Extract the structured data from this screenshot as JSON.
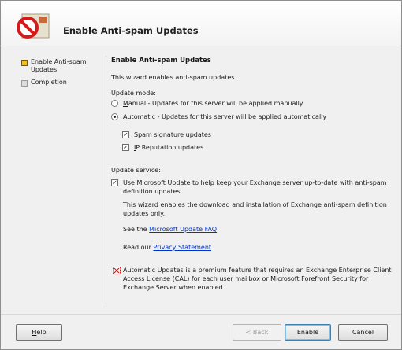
{
  "wizard": {
    "title": "Enable Anti-spam Updates"
  },
  "nav": {
    "items": [
      {
        "label": "Enable Anti-spam Updates",
        "active": true
      },
      {
        "label": "Completion",
        "active": false
      }
    ]
  },
  "page": {
    "heading": "Enable Anti-spam Updates",
    "intro": "This wizard enables anti-spam updates.",
    "update_mode_label": "Update mode:",
    "manual_prefix": "M",
    "manual_label": "anual - Updates for this server will be applied manually",
    "automatic_prefix": "A",
    "automatic_label": "utomatic - Updates for this server will be applied automatically",
    "manual_selected": false,
    "automatic_selected": true,
    "spam_sig_prefix": "S",
    "spam_sig_label": "pam signature updates",
    "spam_sig_checked": true,
    "ip_rep_prefix": "I",
    "ip_rep_label": "P Reputation updates",
    "ip_rep_checked": true,
    "update_service_label": "Update service:",
    "microsoft_update_line1_a": "Use Micr",
    "microsoft_update_line1_u": "o",
    "microsoft_update_line1_b": "soft Update to help keep your Exchange server up-to-date with anti-spam",
    "microsoft_update_line2": "definition updates.",
    "microsoft_update_checked": true,
    "wizard_note_line1": "This wizard enables the download and installation of Exchange anti-spam definition",
    "wizard_note_line2": "updates only.",
    "faq_prefix": "See the ",
    "faq_link": "Microsoft Update FAQ",
    "faq_suffix": ".",
    "privacy_prefix": "Read our ",
    "privacy_link": "Privacy Statement",
    "privacy_suffix": ".",
    "premium_line1": "Automatic Updates is a premium feature that requires an Exchange Enterprise Client",
    "premium_line2": "Access License (CAL) for each user mailbox or Microsoft Forefront Security for",
    "premium_line3": "Exchange Server when enabled."
  },
  "buttons": {
    "help_prefix": "H",
    "help_suffix": "elp",
    "back": "< Back",
    "enable": "Enable",
    "cancel": "Cancel"
  },
  "colors": {
    "link": "#0033cc",
    "nav_active": "#f0c020"
  }
}
